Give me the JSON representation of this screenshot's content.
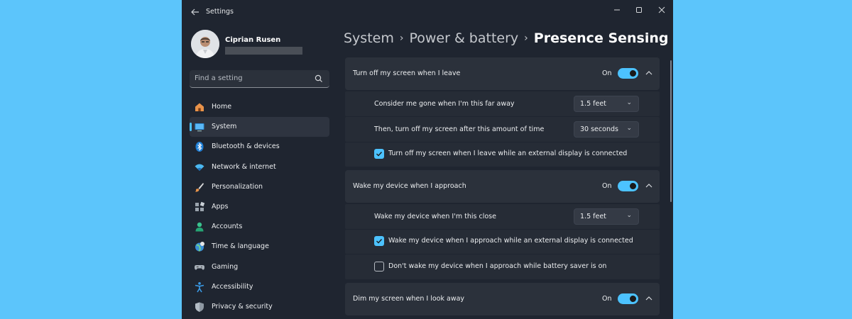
{
  "window": {
    "title": "Settings"
  },
  "profile": {
    "name": "Ciprian Rusen"
  },
  "search": {
    "placeholder": "Find a setting"
  },
  "sidebar": {
    "items": [
      {
        "label": "Home",
        "icon": "home-icon"
      },
      {
        "label": "System",
        "icon": "system-icon",
        "selected": true
      },
      {
        "label": "Bluetooth & devices",
        "icon": "bluetooth-icon"
      },
      {
        "label": "Network & internet",
        "icon": "network-icon"
      },
      {
        "label": "Personalization",
        "icon": "personalization-icon"
      },
      {
        "label": "Apps",
        "icon": "apps-icon"
      },
      {
        "label": "Accounts",
        "icon": "accounts-icon"
      },
      {
        "label": "Time & language",
        "icon": "time-language-icon"
      },
      {
        "label": "Gaming",
        "icon": "gaming-icon"
      },
      {
        "label": "Accessibility",
        "icon": "accessibility-icon"
      },
      {
        "label": "Privacy & security",
        "icon": "privacy-security-icon"
      }
    ]
  },
  "breadcrumb": {
    "part1": "System",
    "part2": "Power & battery",
    "current": "Presence Sensing"
  },
  "sections": {
    "turn_off": {
      "title": "Turn off my screen when I leave",
      "state": "On",
      "gone_distance_label": "Consider me gone when I'm this far away",
      "gone_distance_value": "1.5 feet",
      "delay_label": "Then, turn off my screen after this amount of time",
      "delay_value": "30 seconds",
      "external_label": "Turn off my screen when I leave while an external display is connected",
      "external_checked": true
    },
    "wake": {
      "title": "Wake my device when I approach",
      "state": "On",
      "close_label": "Wake my device when I'm this close",
      "close_value": "1.5 feet",
      "external_label": "Wake my device when I approach while an external display is connected",
      "external_checked": true,
      "battery_saver_label": "Don't wake my device when I approach while battery saver is on",
      "battery_saver_checked": false
    },
    "dim": {
      "title": "Dim my screen when I look away",
      "state": "On"
    }
  },
  "colors": {
    "accent": "#4cc2ff",
    "window_bg": "#1f2530",
    "card_bg": "#2b313b",
    "desktop_bg": "#5cc5fb"
  }
}
